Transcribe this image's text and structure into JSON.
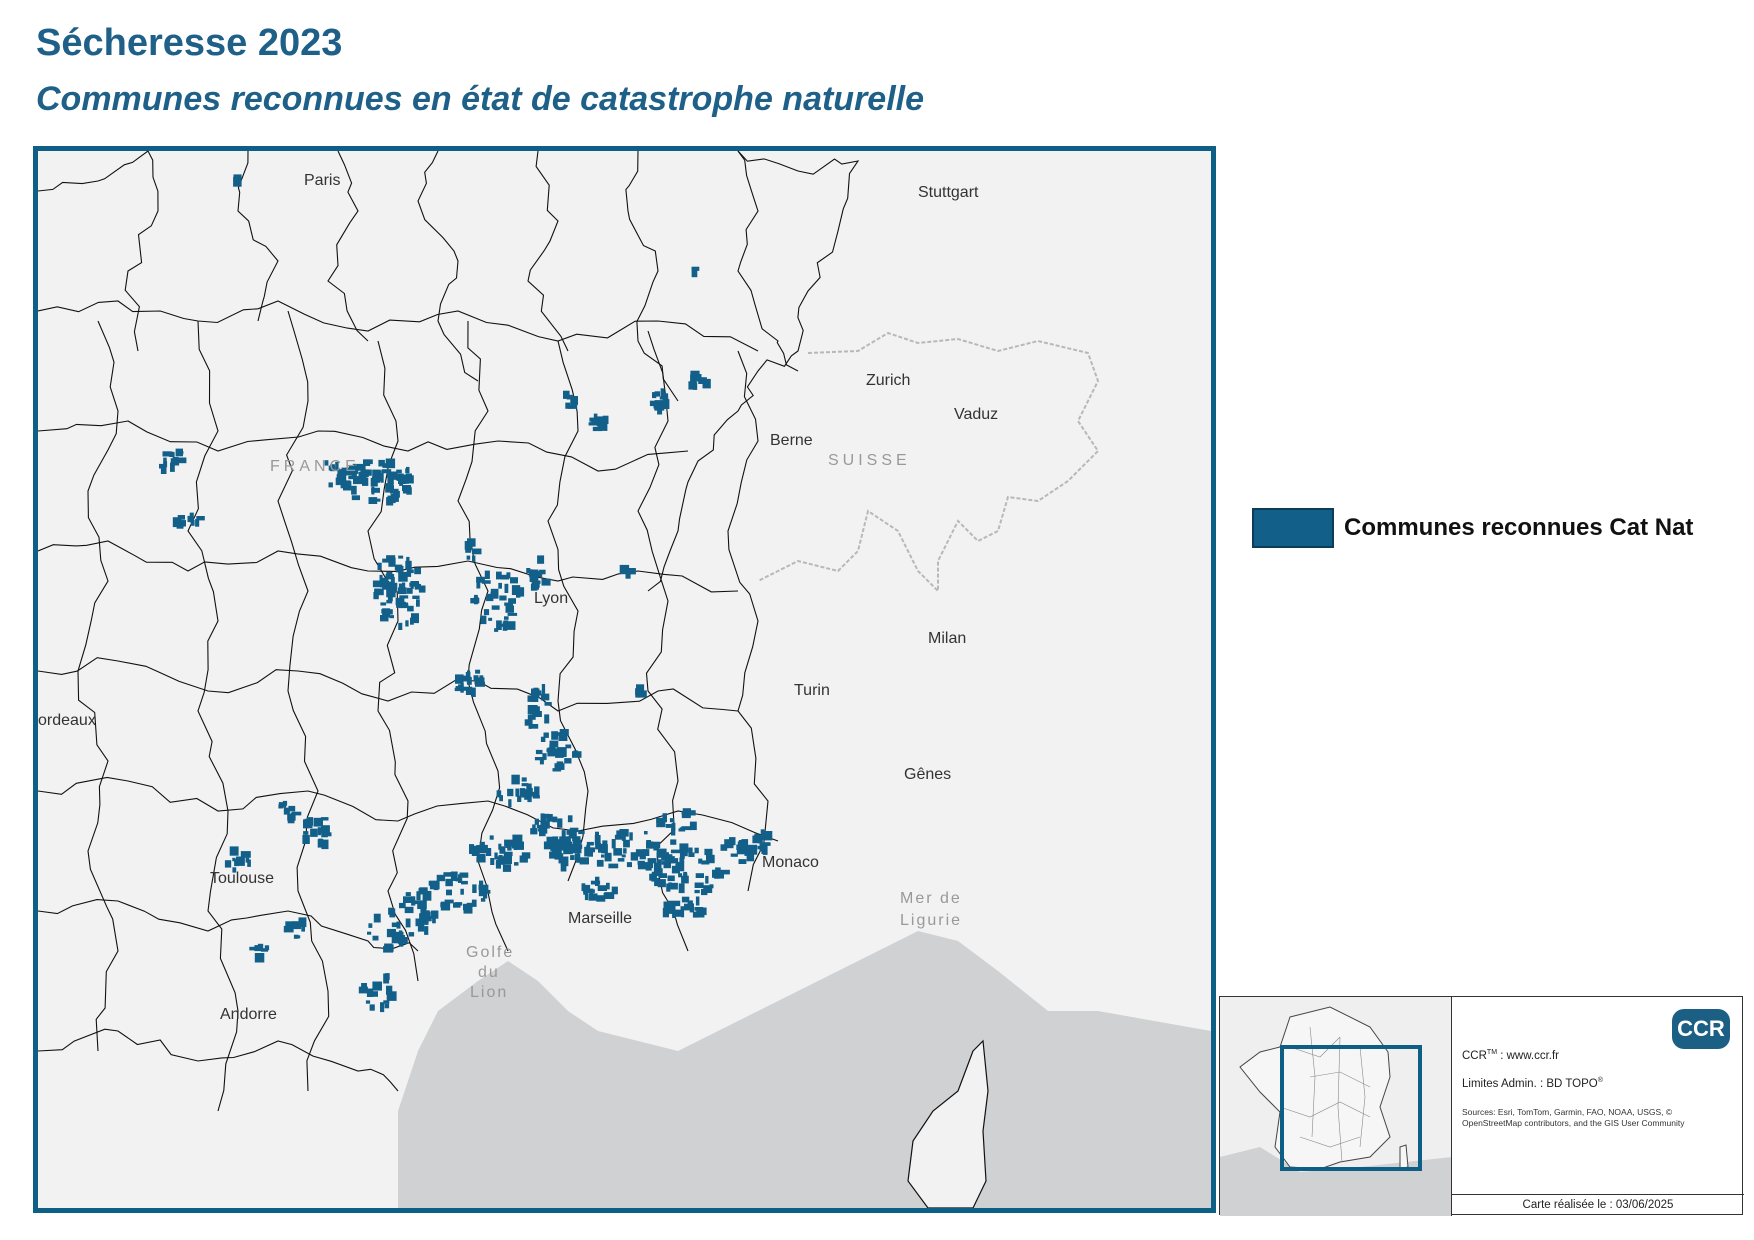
{
  "header": {
    "title": "Sécheresse 2023",
    "subtitle": "Communes reconnues en état de catastrophe naturelle"
  },
  "map": {
    "places": {
      "paris": "Paris",
      "stuttgart": "Stuttgart",
      "zurich": "Zurich",
      "vaduz": "Vaduz",
      "berne": "Berne",
      "lyon": "Lyon",
      "milan": "Milan",
      "turin": "Turin",
      "bordeaux": "ordeaux",
      "genes": "Gênes",
      "toulouse": "Toulouse",
      "monaco": "Monaco",
      "marseille": "Marseille",
      "andorre": "Andorre"
    },
    "regions": {
      "france": "FRANCE",
      "suisse": "SUISSE"
    },
    "seas": {
      "golfe_1": "Golfe",
      "golfe_2": "du",
      "golfe_3": "Lion",
      "mer_1": "Mer de",
      "mer_2": "Ligurie"
    },
    "colors": {
      "highlight": "#12608a",
      "land": "#f2f2f2",
      "sea": "#cfd1d2",
      "border": "#111111",
      "frame": "#0d5f86"
    }
  },
  "legend": {
    "label": "Communes reconnues Cat Nat",
    "color": "#12608a"
  },
  "credits": {
    "logo": "CCR",
    "ccr_prefix": "CCR",
    "ccr_sup": "TM",
    "ccr_url": " : www.ccr.fr",
    "limits_prefix": "Limites Admin. : BD TOPO",
    "limits_sup": "®",
    "sources": "Sources: Esri, TomTom, Garmin, FAO, NOAA, USGS, © OpenStreetMap contributors, and the GIS User Community",
    "date": "Carte réalisée le : 03/06/2025"
  }
}
